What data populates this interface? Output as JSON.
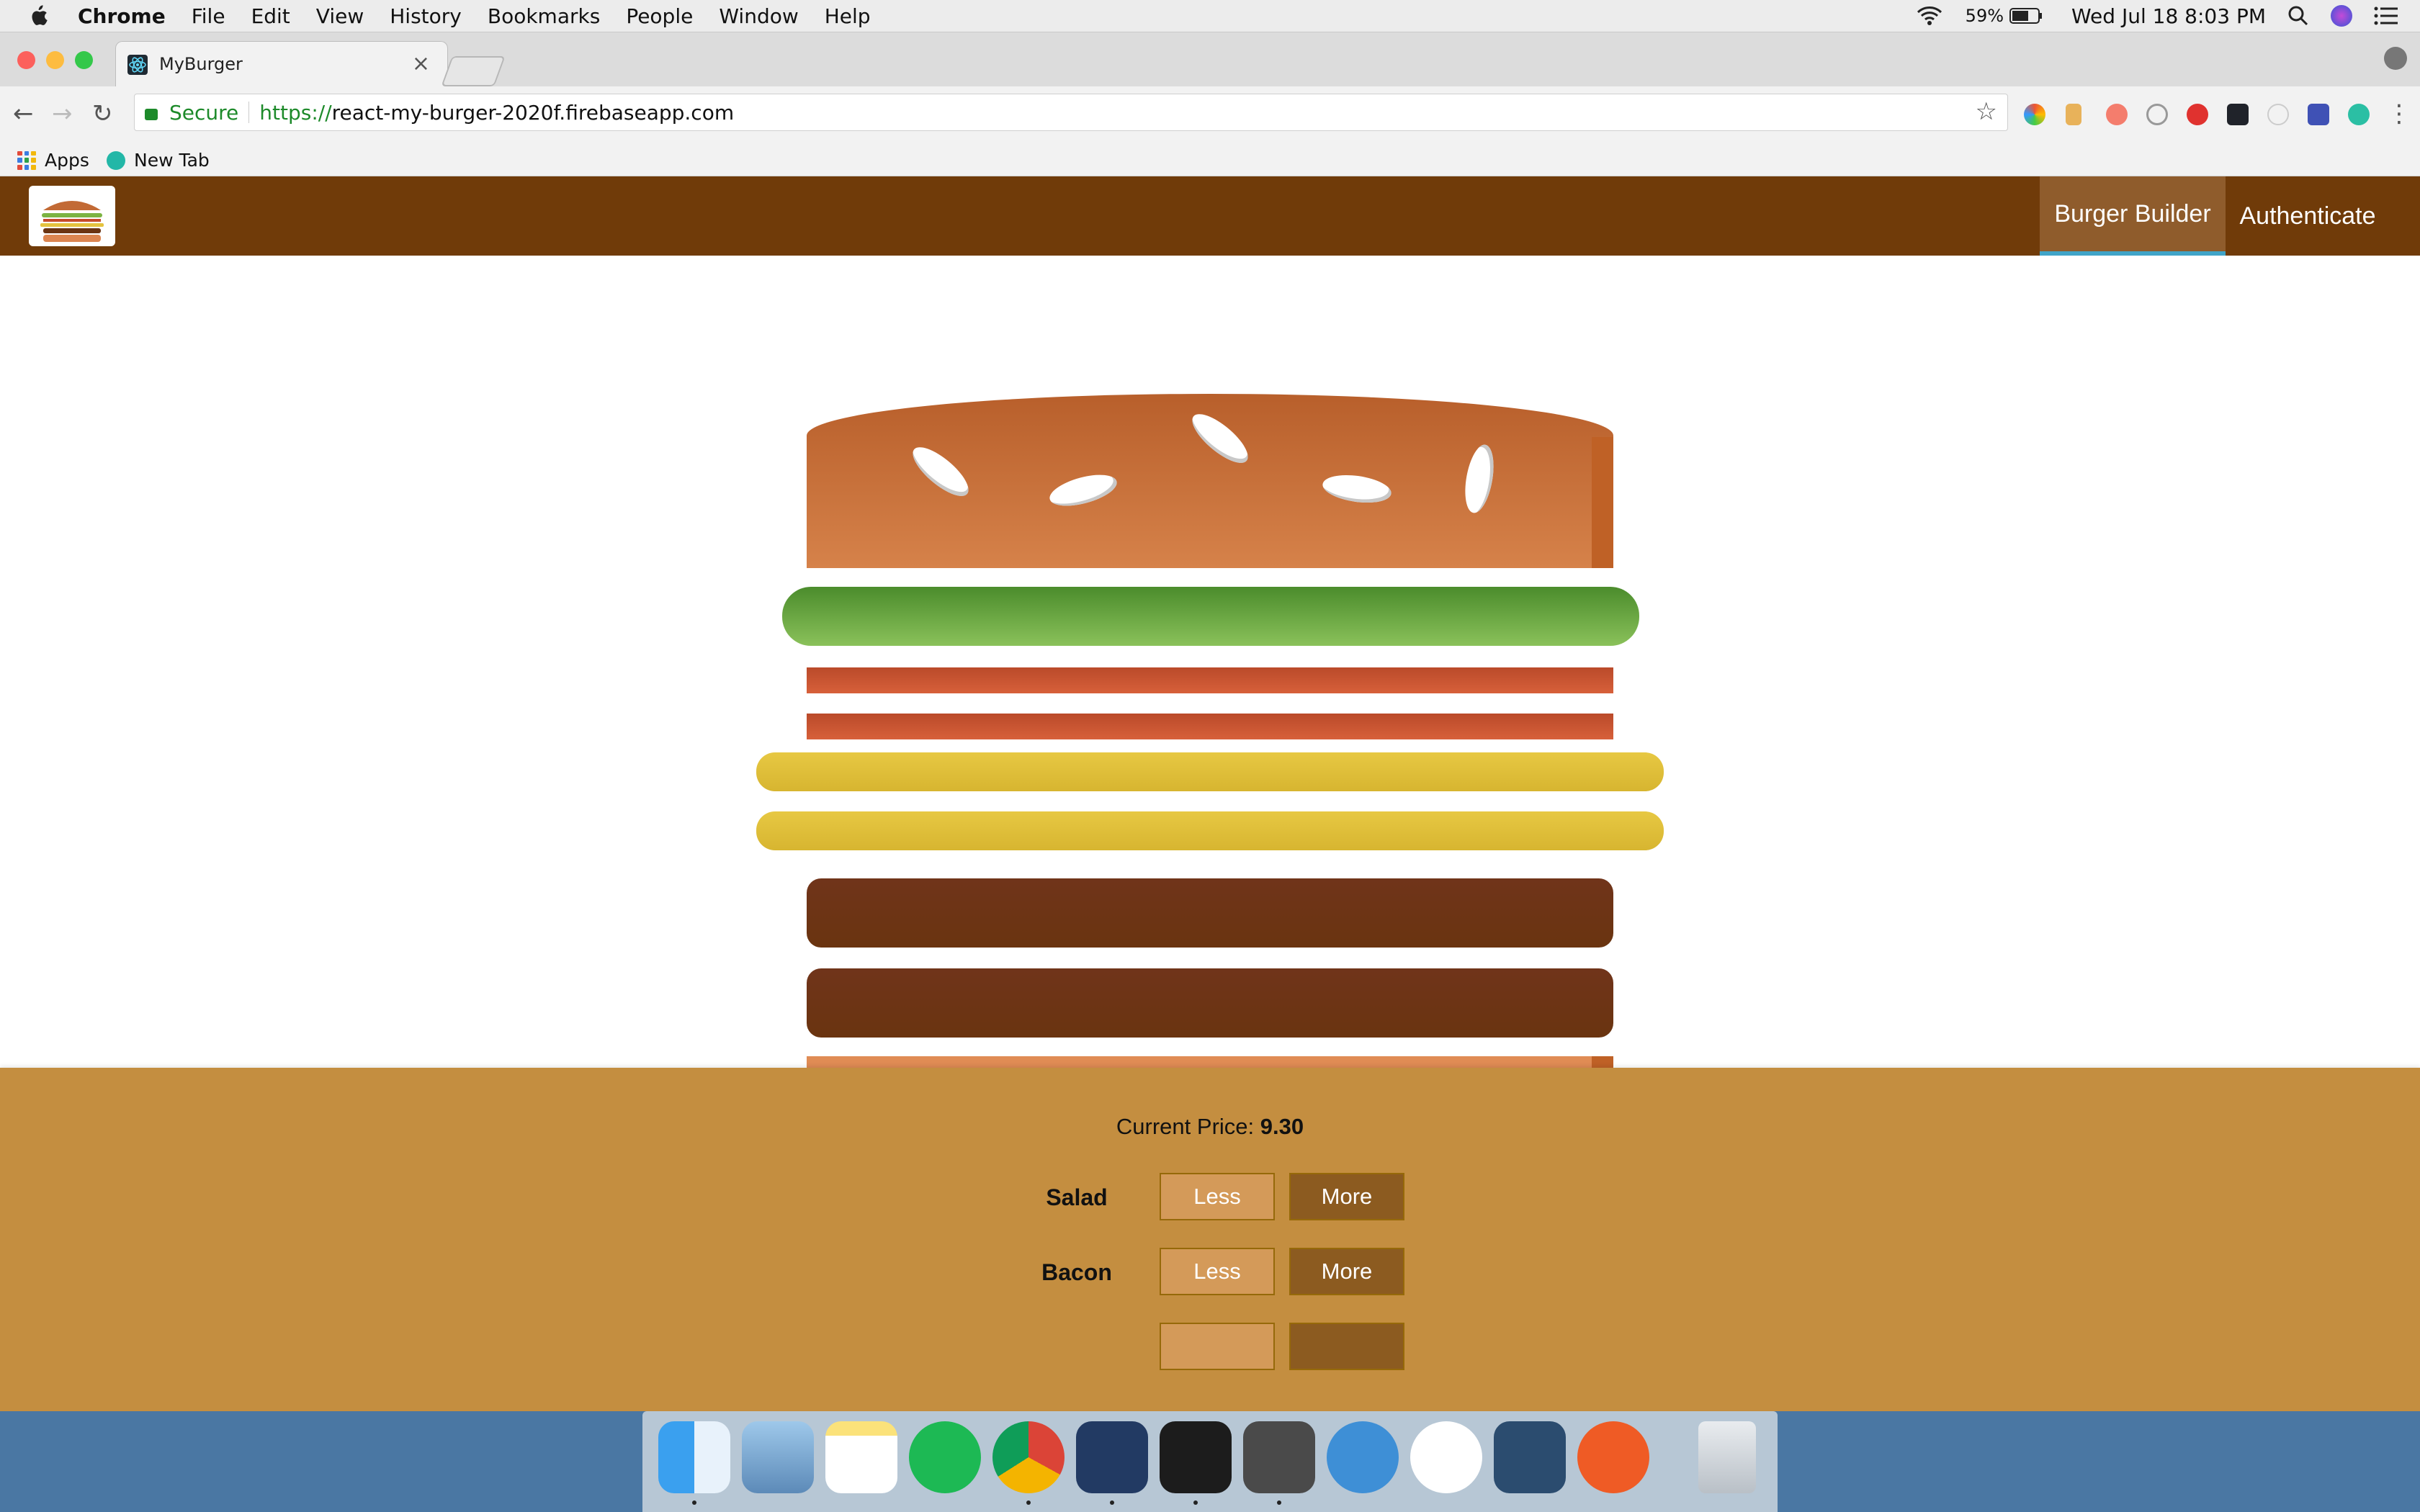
{
  "menubar": {
    "app_name": "Chrome",
    "menus": [
      "File",
      "Edit",
      "View",
      "History",
      "Bookmarks",
      "People",
      "Window",
      "Help"
    ],
    "battery": "59%",
    "datetime": "Wed Jul 18  8:03 PM"
  },
  "browser": {
    "tab_title": "MyBurger",
    "tab_close": "×",
    "secure_label": "Secure",
    "url_scheme": "https://",
    "url_host": "react-my-burger-2020f.firebaseapp.com",
    "bookmarks": [
      "Apps",
      "New Tab"
    ]
  },
  "app": {
    "nav": [
      {
        "label": "Burger Builder",
        "active": true
      },
      {
        "label": "Authenticate",
        "active": false
      }
    ],
    "ingredients": {
      "salad": 1,
      "bacon": 2,
      "cheese": 2,
      "meat": 2
    },
    "build_controls": {
      "price_label": "Current Price: ",
      "price_value": "9.30",
      "controls": [
        {
          "label": "Salad",
          "less": "Less",
          "more": "More"
        },
        {
          "label": "Bacon",
          "less": "Less",
          "more": "More"
        }
      ]
    }
  },
  "colors": {
    "appbar": "#703b09",
    "controls_bg": "#c48e40",
    "active_nav_underline": "#40a4c8"
  },
  "dock_apps": [
    "finder-icon",
    "preview-icon",
    "notes-icon",
    "spotify-icon",
    "chrome-icon",
    "vscode-icon",
    "terminal-icon",
    "sublime-icon",
    "markdown-icon",
    "mongodb-icon",
    "mysql-workbench-icon",
    "postman-icon",
    "trash-icon"
  ]
}
